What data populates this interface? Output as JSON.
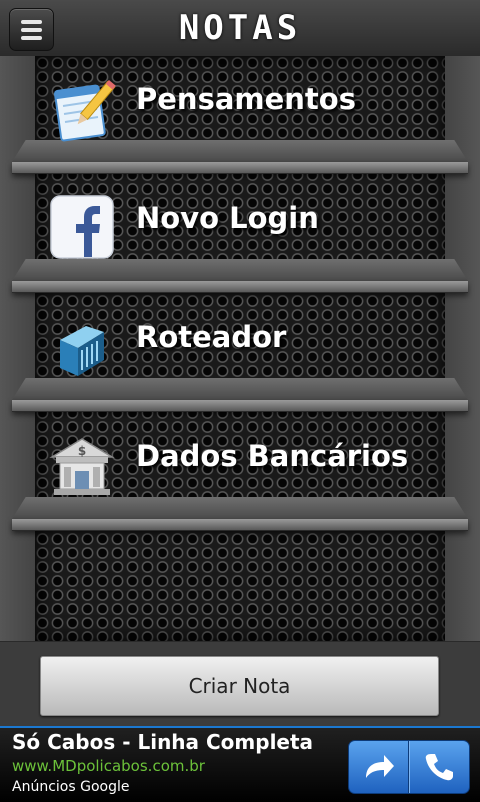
{
  "app": {
    "title": "NOTAS"
  },
  "titlebar": {
    "menu_icon": "menu-icon"
  },
  "notes": [
    {
      "label": "Pensamentos",
      "icon": "notepad-pencil-icon"
    },
    {
      "label": "Novo Login",
      "icon": "facebook-icon"
    },
    {
      "label": "Roteador",
      "icon": "router-icon"
    },
    {
      "label": "Dados Bancários",
      "icon": "bank-icon"
    }
  ],
  "actions": {
    "create_note": "Criar Nota"
  },
  "ad": {
    "title": "Só Cabos - Linha Completa",
    "url": "www.MDpolicabos.com.br",
    "attribution": "Anúncios Google",
    "action_icons": [
      "share-arrow-icon",
      "phone-icon"
    ],
    "accent_color": "#1b78d0"
  }
}
